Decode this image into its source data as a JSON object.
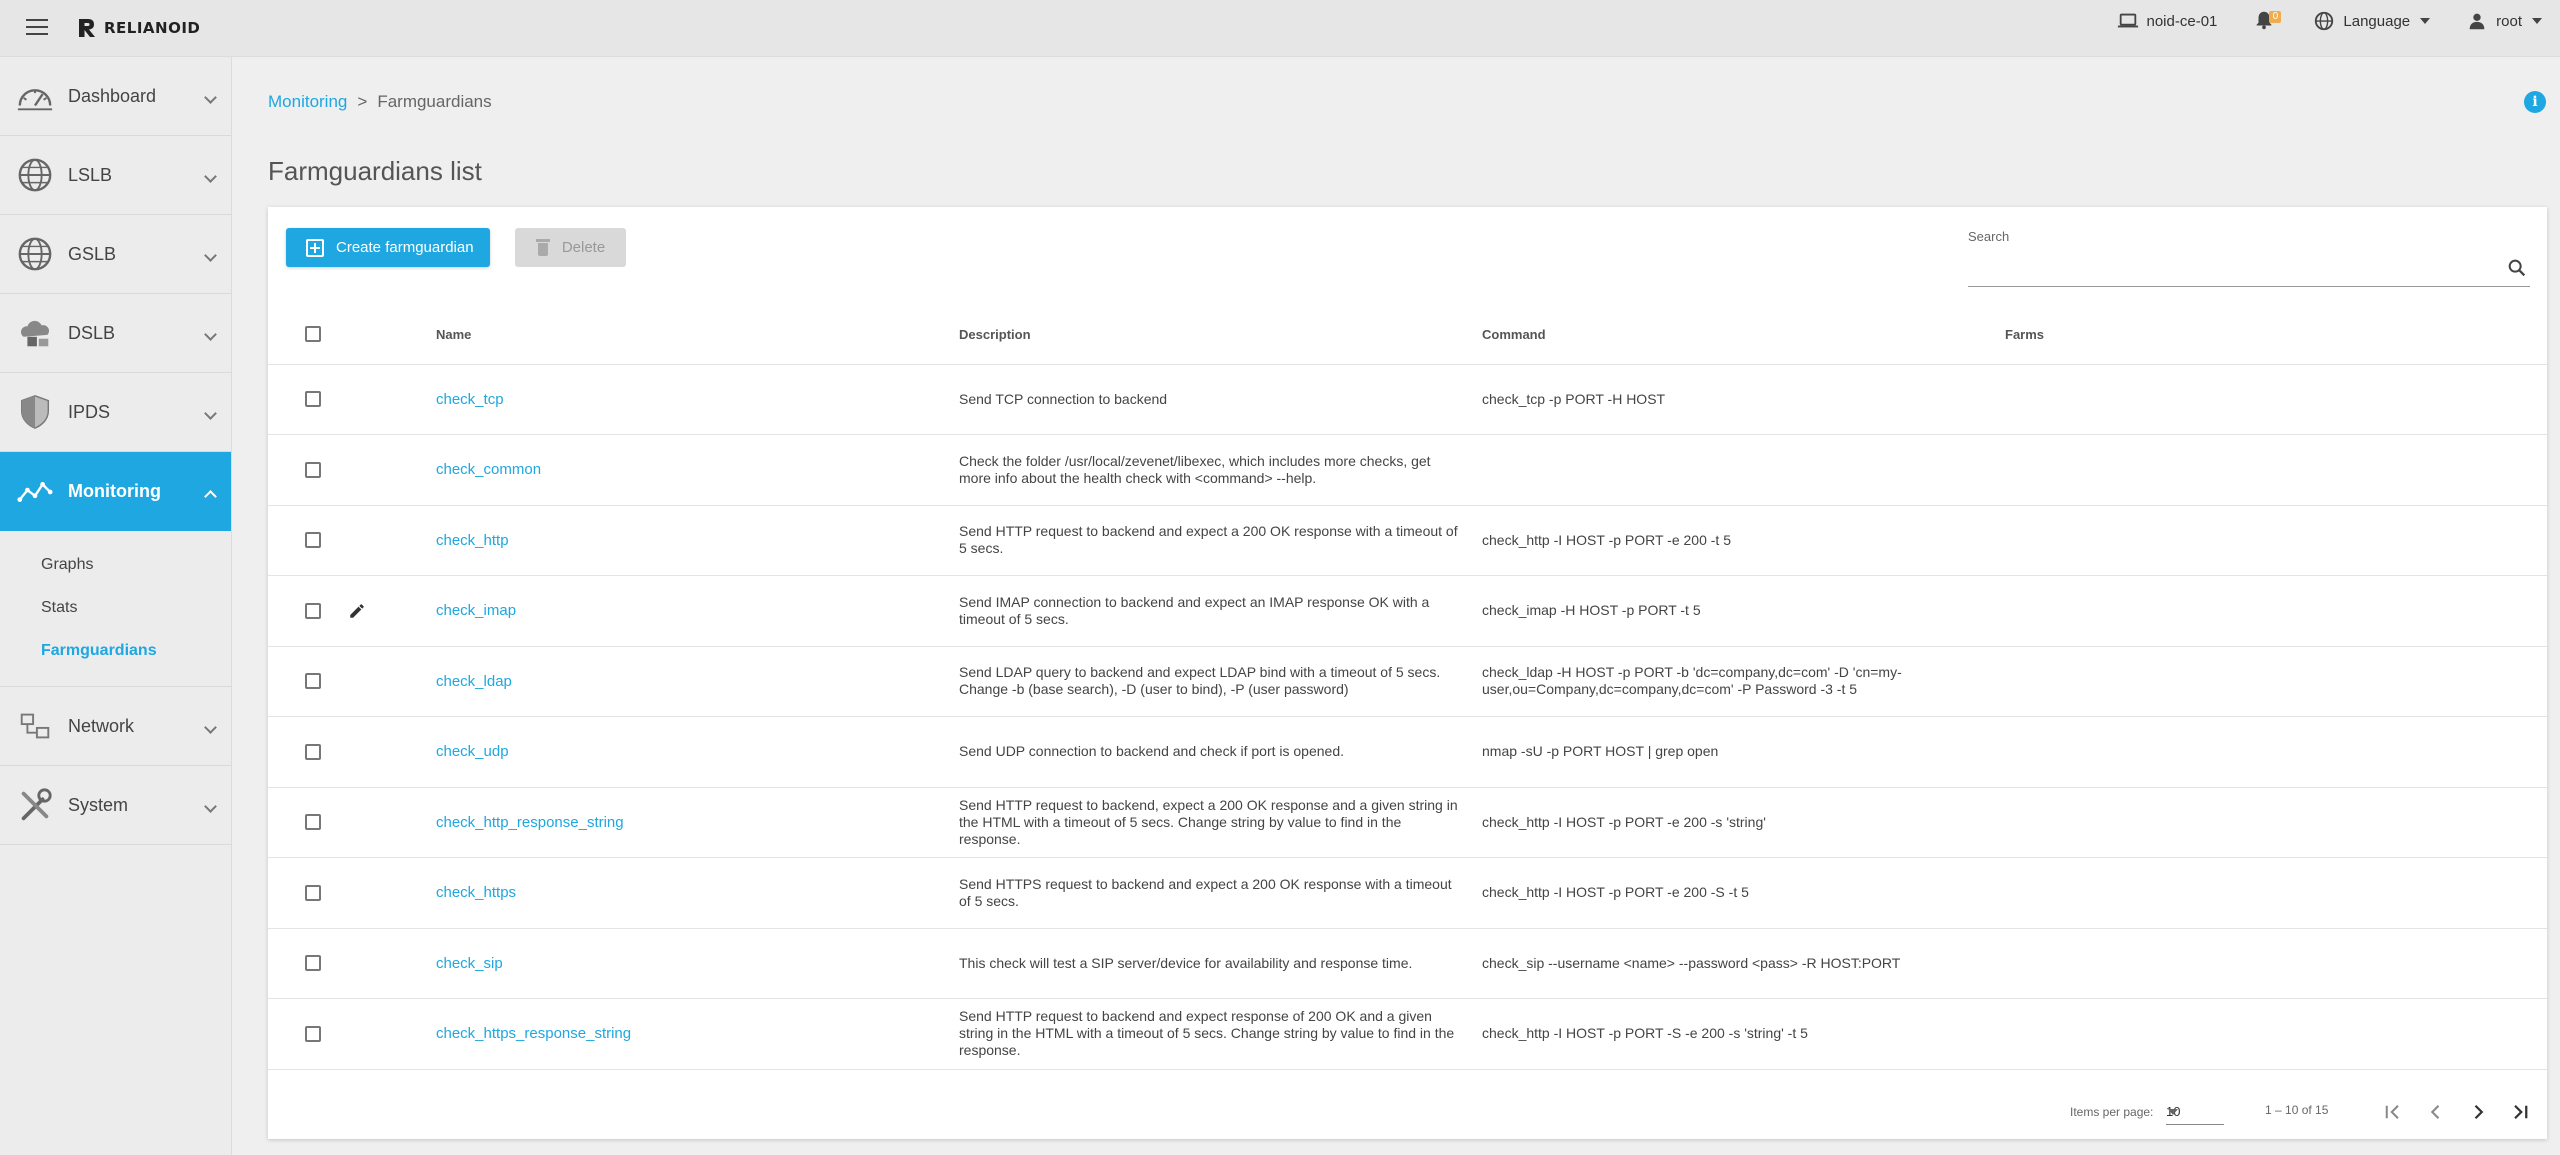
{
  "app": {
    "logo_text": "RELIANOID"
  },
  "topbar": {
    "host": "noid-ce-01",
    "notifications": "0",
    "language": "Language",
    "user": "root"
  },
  "sidebar": {
    "items": [
      {
        "label": "Dashboard",
        "icon": "dashboard-icon"
      },
      {
        "label": "LSLB",
        "icon": "globe-icon"
      },
      {
        "label": "GSLB",
        "icon": "globe-icon"
      },
      {
        "label": "DSLB",
        "icon": "cloud-icon"
      },
      {
        "label": "IPDS",
        "icon": "shield-icon"
      },
      {
        "label": "Monitoring",
        "icon": "monitoring-icon",
        "active": true
      },
      {
        "label": "Network",
        "icon": "network-icon"
      },
      {
        "label": "System",
        "icon": "tools-icon"
      }
    ],
    "monitoring_sub": [
      "Graphs",
      "Stats",
      "Farmguardians"
    ]
  },
  "breadcrumb": {
    "parent": "Monitoring",
    "separator": ">",
    "current": "Farmguardians"
  },
  "page_title": "Farmguardians list",
  "toolbar": {
    "create_label": "Create farmguardian",
    "delete_label": "Delete"
  },
  "search": {
    "label": "Search",
    "value": ""
  },
  "table": {
    "columns": {
      "name": "Name",
      "description": "Description",
      "command": "Command",
      "farms": "Farms"
    },
    "rows": [
      {
        "name": "check_tcp",
        "description": "Send TCP connection to backend",
        "command": "check_tcp -p PORT -H HOST",
        "farms": ""
      },
      {
        "name": "check_common",
        "description": "Check the folder /usr/local/zevenet/libexec, which includes more checks, get more info about the health check with <command> --help.",
        "command": "",
        "farms": ""
      },
      {
        "name": "check_http",
        "description": "Send HTTP request to backend and expect a 200 OK response with a timeout of 5 secs.",
        "command": "check_http -I HOST -p PORT -e 200 -t 5",
        "farms": ""
      },
      {
        "name": "check_imap",
        "description": "Send IMAP connection to backend and expect an IMAP response OK with a timeout of 5 secs.",
        "command": "check_imap -H HOST -p PORT -t 5",
        "farms": ""
      },
      {
        "name": "check_ldap",
        "description": "Send LDAP query to backend and expect LDAP bind with a timeout of 5 secs. Change -b (base search), -D (user to bind), -P (user password)",
        "command": "check_ldap -H HOST -p PORT -b 'dc=company,dc=com' -D 'cn=my-user,ou=Company,dc=company,dc=com' -P Password -3 -t 5",
        "farms": ""
      },
      {
        "name": "check_udp",
        "description": "Send UDP connection to backend and check if port is opened.",
        "command": "nmap -sU -p PORT HOST | grep open",
        "farms": ""
      },
      {
        "name": "check_http_response_string",
        "description": "Send HTTP request to backend, expect a 200 OK response and a given string in the HTML with a timeout of 5 secs. Change string by value to find in the response.",
        "command": "check_http -I HOST -p PORT -e 200 -s 'string'",
        "farms": ""
      },
      {
        "name": "check_https",
        "description": "Send HTTPS request to backend and expect a 200 OK response with a timeout of 5 secs.",
        "command": "check_http -I HOST -p PORT -e 200 -S -t 5",
        "farms": ""
      },
      {
        "name": "check_sip",
        "description": "This check will test a SIP server/device for availability and response time.",
        "command": "check_sip --username <name> --password <pass> -R HOST:PORT",
        "farms": ""
      },
      {
        "name": "check_https_response_string",
        "description": "Send HTTP request to backend and expect response of 200 OK and a given string in the HTML with a timeout of 5 secs. Change string by value to find in the response.",
        "command": "check_http -I HOST -p PORT -S -e 200 -s 'string' -t 5",
        "farms": ""
      }
    ]
  },
  "paginator": {
    "items_per_page_label": "Items per page:",
    "page_size": "10",
    "range": "1 – 10 of 15"
  },
  "colors": {
    "accent": "#1ea7e1",
    "badge": "#f0ad4e"
  }
}
